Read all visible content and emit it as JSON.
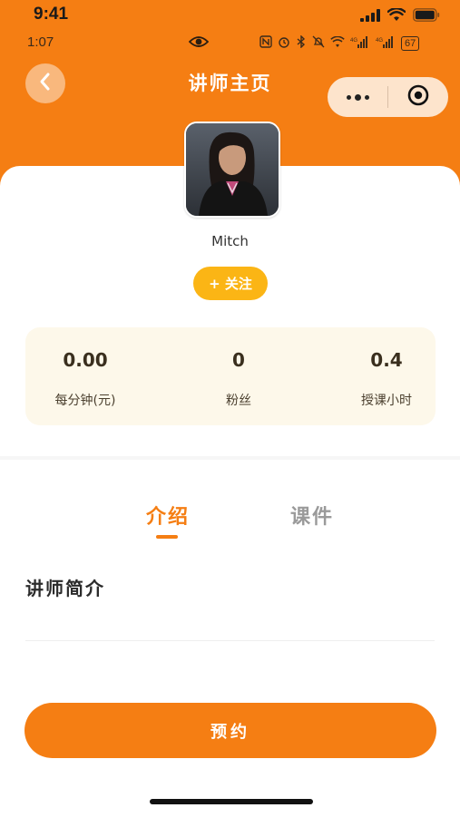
{
  "status_bar": {
    "time": "9:41"
  },
  "system_bar": {
    "time": "1:07",
    "battery": "67"
  },
  "nav": {
    "title": "讲师主页"
  },
  "profile": {
    "name": "Mitch",
    "follow_label": "+ 关注"
  },
  "stats": [
    {
      "value": "0.00",
      "label": "每分钟(元)"
    },
    {
      "value": "0",
      "label": "粉丝"
    },
    {
      "value": "0.4",
      "label": "授课小时"
    }
  ],
  "tabs": [
    {
      "label": "介绍",
      "active": true
    },
    {
      "label": "课件",
      "active": false
    }
  ],
  "intro": {
    "title": "讲师简介"
  },
  "actions": {
    "book_label": "预约"
  },
  "colors": {
    "primary": "#f57e13",
    "follow": "#fbb515",
    "stats_bg": "#fdf8ea",
    "capsule_bg": "#fde4cc"
  },
  "icons": [
    "back-arrow-icon",
    "more-dots-icon",
    "target-close-icon",
    "eye-icon",
    "signal-icon",
    "wifi-icon",
    "battery-icon"
  ]
}
